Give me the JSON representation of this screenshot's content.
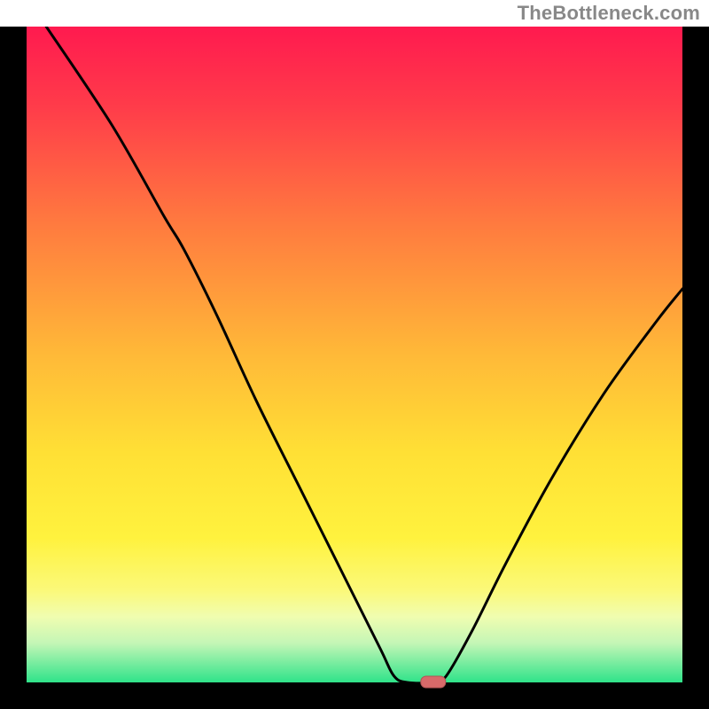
{
  "watermark": "TheBottleneck.com",
  "colors": {
    "border": "#000000",
    "curve": "#000000",
    "marker_fill": "#d76a6a",
    "marker_stroke": "#b05454",
    "gradient_stops": [
      {
        "offset": "0%",
        "color": "#ff1a4f"
      },
      {
        "offset": "12%",
        "color": "#ff3b4a"
      },
      {
        "offset": "30%",
        "color": "#ff7a3f"
      },
      {
        "offset": "50%",
        "color": "#ffb938"
      },
      {
        "offset": "65%",
        "color": "#ffe035"
      },
      {
        "offset": "78%",
        "color": "#fff23e"
      },
      {
        "offset": "86%",
        "color": "#fbf97a"
      },
      {
        "offset": "90%",
        "color": "#f0fdb0"
      },
      {
        "offset": "94%",
        "color": "#c4f6b6"
      },
      {
        "offset": "100%",
        "color": "#2fe38a"
      }
    ]
  },
  "chart_data": {
    "type": "line",
    "title": "",
    "xlabel": "",
    "ylabel": "",
    "x_range": [
      0,
      100
    ],
    "y_range": [
      0,
      100
    ],
    "curve": [
      {
        "x": 3,
        "y": 100
      },
      {
        "x": 13,
        "y": 85
      },
      {
        "x": 21,
        "y": 71
      },
      {
        "x": 24,
        "y": 66
      },
      {
        "x": 29,
        "y": 56
      },
      {
        "x": 35,
        "y": 43
      },
      {
        "x": 42,
        "y": 29
      },
      {
        "x": 49,
        "y": 15
      },
      {
        "x": 54,
        "y": 5
      },
      {
        "x": 56,
        "y": 1
      },
      {
        "x": 58,
        "y": 0
      },
      {
        "x": 62,
        "y": 0
      },
      {
        "x": 64,
        "y": 1
      },
      {
        "x": 68,
        "y": 8
      },
      {
        "x": 73,
        "y": 18
      },
      {
        "x": 80,
        "y": 31
      },
      {
        "x": 88,
        "y": 44
      },
      {
        "x": 96,
        "y": 55
      },
      {
        "x": 100,
        "y": 60
      }
    ],
    "marker": {
      "x": 62,
      "y": 0
    },
    "notes": "x and y are in percent of the inner plot area; curve plotted as smooth path"
  }
}
